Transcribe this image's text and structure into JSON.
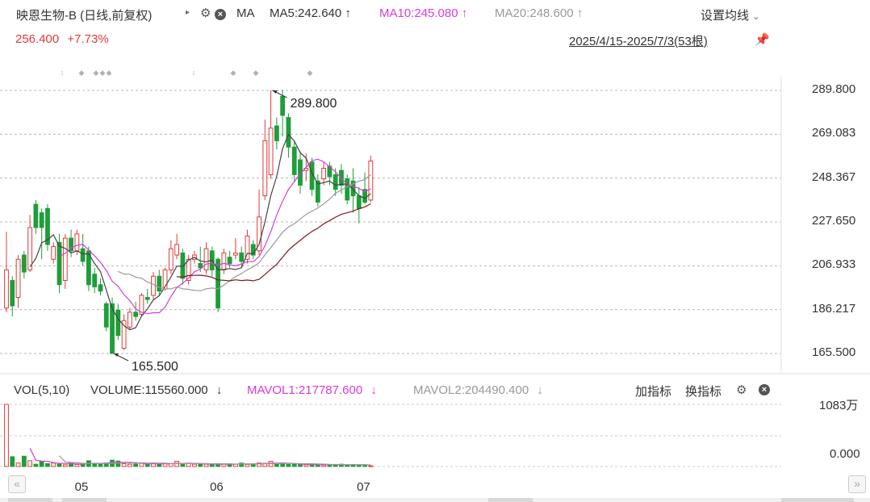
{
  "header": {
    "title": "映恩生物-B (日线,前复权)",
    "ma_label": "MA",
    "ma5": "MA5:242.640",
    "ma10": "MA10:245.080",
    "ma20": "MA20:248.600",
    "settings": "设置均线",
    "price": "256.400",
    "change": "+7.73%",
    "date_range": "2025/4/15-2025/7/3(53根)"
  },
  "volume_header": {
    "name": "VOL(5,10)",
    "volume": "VOLUME:115560.000",
    "mavol1": "MAVOL1:217787.600",
    "mavol2": "MAVOL2:204490.400",
    "add_indicator": "加指标",
    "swap_indicator": "换指标"
  },
  "colors": {
    "up": "#e03a3a",
    "down": "#1f9d3a",
    "ma5": "#444444",
    "ma10": "#d83bd8",
    "ma20": "#9a9a9a",
    "ma_long": "#7a1a1a"
  },
  "icons": [
    "gear-icon",
    "close-circle-icon",
    "pin-icon",
    "chevron-down-icon",
    "arrow-icon",
    "scroll-left-icon",
    "scroll-right-icon"
  ],
  "chart_data": {
    "type": "candlestick",
    "y_ticks": [
      "289.800",
      "269.083",
      "248.367",
      "227.650",
      "206.933",
      "186.217",
      "165.500"
    ],
    "ylim": [
      165.5,
      289.8
    ],
    "x_ticks": [
      "05",
      "06",
      "07"
    ],
    "x_tick_index": [
      13,
      36,
      61
    ],
    "annotations": [
      {
        "label": "289.800",
        "index": 45,
        "value": 289.8,
        "side": "right"
      },
      {
        "label": "165.500",
        "index": 18,
        "value": 165.5,
        "side": "right"
      }
    ],
    "candles": [
      {
        "o": 187,
        "c": 205,
        "h": 223,
        "l": 185
      },
      {
        "o": 200,
        "c": 188,
        "h": 202,
        "l": 183
      },
      {
        "o": 192,
        "c": 210,
        "h": 212,
        "l": 187
      },
      {
        "o": 212,
        "c": 204,
        "h": 214,
        "l": 201
      },
      {
        "o": 205,
        "c": 225,
        "h": 231,
        "l": 204
      },
      {
        "o": 236,
        "c": 225,
        "h": 238,
        "l": 222
      },
      {
        "o": 232,
        "c": 225,
        "h": 234,
        "l": 210
      },
      {
        "o": 234,
        "c": 217,
        "h": 236,
        "l": 214
      },
      {
        "o": 210,
        "c": 216,
        "h": 218,
        "l": 208
      },
      {
        "o": 218,
        "c": 198,
        "h": 222,
        "l": 194
      },
      {
        "o": 200,
        "c": 220,
        "h": 222,
        "l": 196
      },
      {
        "o": 220,
        "c": 214,
        "h": 224,
        "l": 211
      },
      {
        "o": 214,
        "c": 222,
        "h": 224,
        "l": 212
      },
      {
        "o": 215,
        "c": 209,
        "h": 222,
        "l": 207
      },
      {
        "o": 214,
        "c": 198,
        "h": 216,
        "l": 195
      },
      {
        "o": 203,
        "c": 197,
        "h": 206,
        "l": 194
      },
      {
        "o": 198,
        "c": 195,
        "h": 201,
        "l": 193
      },
      {
        "o": 189,
        "c": 178,
        "h": 190,
        "l": 176
      },
      {
        "o": 189,
        "c": 165.5,
        "h": 192,
        "l": 165.5
      },
      {
        "o": 186,
        "c": 174,
        "h": 189,
        "l": 172
      },
      {
        "o": 168,
        "c": 181,
        "h": 184,
        "l": 167
      },
      {
        "o": 178,
        "c": 185,
        "h": 187,
        "l": 177
      },
      {
        "o": 185,
        "c": 183,
        "h": 190,
        "l": 181
      },
      {
        "o": 184,
        "c": 193,
        "h": 194,
        "l": 183
      },
      {
        "o": 192,
        "c": 191,
        "h": 196,
        "l": 189
      },
      {
        "o": 193,
        "c": 202,
        "h": 204,
        "l": 191
      },
      {
        "o": 202,
        "c": 195,
        "h": 205,
        "l": 193
      },
      {
        "o": 196,
        "c": 205,
        "h": 206,
        "l": 195
      },
      {
        "o": 205,
        "c": 215,
        "h": 219,
        "l": 203
      },
      {
        "o": 212,
        "c": 217,
        "h": 222,
        "l": 210
      },
      {
        "o": 213,
        "c": 201,
        "h": 215,
        "l": 198
      },
      {
        "o": 200,
        "c": 210,
        "h": 212,
        "l": 198
      },
      {
        "o": 210,
        "c": 212,
        "h": 214,
        "l": 208
      },
      {
        "o": 208,
        "c": 206,
        "h": 216,
        "l": 204
      },
      {
        "o": 205,
        "c": 215,
        "h": 218,
        "l": 203
      },
      {
        "o": 214,
        "c": 205,
        "h": 216,
        "l": 202
      },
      {
        "o": 210,
        "c": 187,
        "h": 211,
        "l": 185
      },
      {
        "o": 205,
        "c": 213,
        "h": 215,
        "l": 203
      },
      {
        "o": 211,
        "c": 208,
        "h": 214,
        "l": 206
      },
      {
        "o": 212,
        "c": 213,
        "h": 220,
        "l": 210
      },
      {
        "o": 213,
        "c": 209,
        "h": 216,
        "l": 206
      },
      {
        "o": 210,
        "c": 221,
        "h": 224,
        "l": 208
      },
      {
        "o": 217,
        "c": 212,
        "h": 219,
        "l": 210
      },
      {
        "o": 214,
        "c": 230,
        "h": 243,
        "l": 212
      },
      {
        "o": 240,
        "c": 266,
        "h": 276,
        "l": 238
      },
      {
        "o": 250,
        "c": 272,
        "h": 289.8,
        "l": 248
      },
      {
        "o": 273,
        "c": 266,
        "h": 277,
        "l": 262
      },
      {
        "o": 287,
        "c": 278,
        "h": 290,
        "l": 268
      },
      {
        "o": 277,
        "c": 263,
        "h": 279,
        "l": 258
      },
      {
        "o": 263,
        "c": 250,
        "h": 266,
        "l": 247
      },
      {
        "o": 257,
        "c": 245,
        "h": 261,
        "l": 241
      },
      {
        "o": 252,
        "c": 253,
        "h": 260,
        "l": 247
      },
      {
        "o": 256,
        "c": 243,
        "h": 258,
        "l": 240
      },
      {
        "o": 247,
        "c": 237,
        "h": 250,
        "l": 235
      },
      {
        "o": 248,
        "c": 253,
        "h": 256,
        "l": 245
      },
      {
        "o": 254,
        "c": 249,
        "h": 256,
        "l": 245
      },
      {
        "o": 250,
        "c": 243,
        "h": 253,
        "l": 240
      },
      {
        "o": 252,
        "c": 245,
        "h": 255,
        "l": 241
      },
      {
        "o": 248,
        "c": 238,
        "h": 250,
        "l": 236
      },
      {
        "o": 247,
        "c": 240,
        "h": 253,
        "l": 232
      },
      {
        "o": 240,
        "c": 234,
        "h": 244,
        "l": 227
      },
      {
        "o": 243,
        "c": 237,
        "h": 251,
        "l": 236
      },
      {
        "o": 238,
        "c": 256.4,
        "h": 259,
        "l": 237
      }
    ],
    "volume": {
      "y_ticks": [
        "1083万",
        "0.000"
      ],
      "ylim": [
        0,
        1083
      ],
      "values": [
        1083,
        170,
        60,
        180,
        100,
        40,
        90,
        50,
        60,
        40,
        30,
        60,
        35,
        40,
        100,
        45,
        50,
        60,
        110,
        95,
        50,
        40,
        45,
        55,
        35,
        60,
        40,
        55,
        50,
        90,
        35,
        55,
        40,
        45,
        40,
        30,
        50,
        40,
        45,
        40,
        60,
        35,
        45,
        60,
        55,
        90,
        40,
        60,
        35,
        40,
        30,
        30,
        40,
        35,
        25,
        30,
        25,
        40,
        25,
        35,
        30,
        25,
        12
      ]
    }
  }
}
